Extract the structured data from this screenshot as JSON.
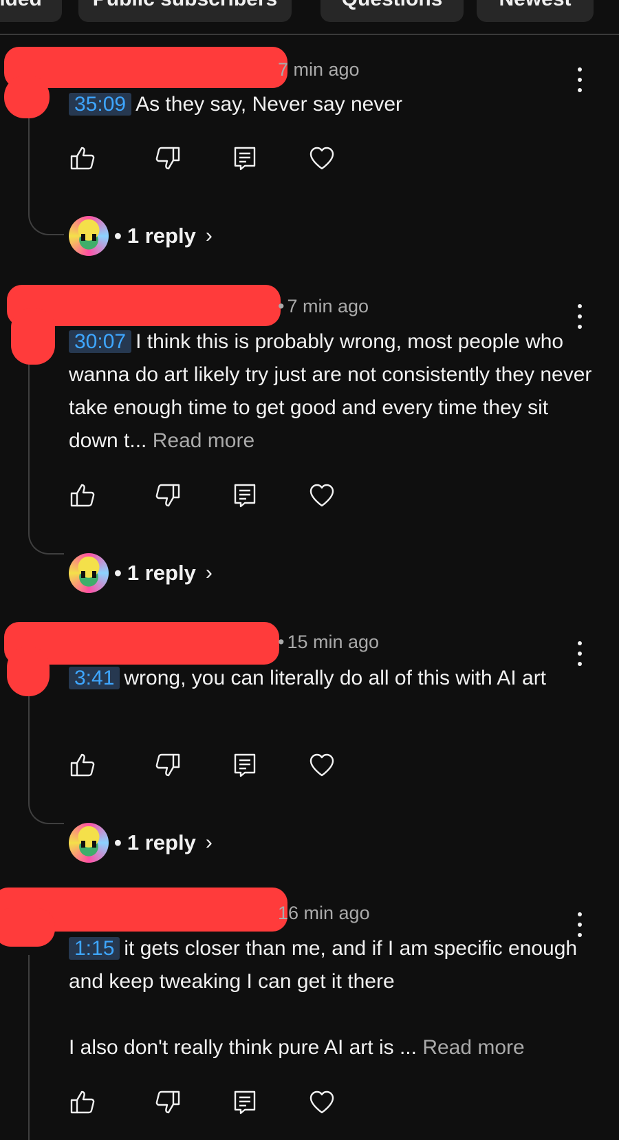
{
  "filter_chips": [
    "nded",
    "Public subscribers",
    "Questions",
    "Newest"
  ],
  "comments": [
    {
      "time": "7 min ago",
      "timestamp": "35:09",
      "text": "As they say, Never say never",
      "read_more": "",
      "reply_label": "1 reply"
    },
    {
      "time": "7 min ago",
      "timestamp": "30:07",
      "text": "I think this is probably wrong, most people who wanna do art likely try just are not consistently they never take enough time to get good and every time they sit down t...",
      "read_more": "Read more",
      "reply_label": "1 reply"
    },
    {
      "time": "15 min ago",
      "timestamp": "3:41",
      "text": "wrong, you can literally do all of this with AI art",
      "read_more": "",
      "reply_label": "1 reply"
    },
    {
      "time": "16 min ago",
      "timestamp": "1:15",
      "text": "it gets closer than me, and if I am specific enough and keep tweaking I can get it there\n\nI also don't really think pure AI art is ...",
      "read_more": "Read more",
      "reply_label": ""
    }
  ],
  "icons": {
    "like": "thumbs-up-icon",
    "dislike": "thumbs-down-icon",
    "reply": "comment-icon",
    "heart": "heart-icon",
    "menu": "more-vertical-icon"
  },
  "colors": {
    "background": "#0f0f0f",
    "timestamp_link": "#3ea6ff",
    "timestamp_bg": "#263850",
    "redaction": "#ff3b3b",
    "secondary_text": "#aaaaaa"
  }
}
